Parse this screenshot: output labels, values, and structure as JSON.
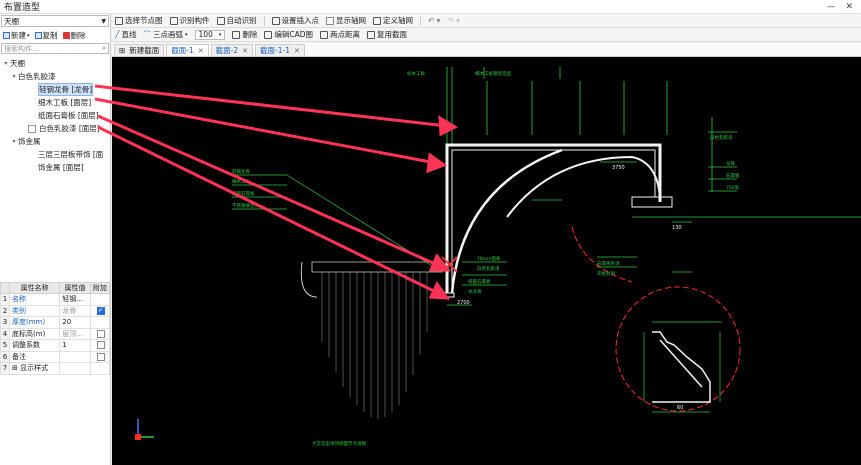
{
  "window": {
    "title": "布置造型",
    "minimize": "—",
    "close": "✕"
  },
  "left": {
    "category_select": "天棚",
    "toolbar": {
      "new_label": "新建",
      "copy_label": "复制",
      "delete_label": "删除"
    },
    "search_placeholder": "搜索构件...",
    "tree": {
      "root": "天棚",
      "group1": "白色乳胶漆",
      "g1_items": [
        "轻钢龙骨 [龙骨]",
        "细木工板 [面层]",
        "纸面石膏板 [面层]"
      ],
      "g1_sub": "白色乳胶漆 [面层]",
      "group2": "饰金属",
      "g2_items": [
        "三层三层板带饰 [面",
        "饰金属 [面层]"
      ]
    }
  },
  "props": {
    "headers": [
      "属性名称",
      "属性值",
      "附加"
    ],
    "rows": [
      {
        "num": "1",
        "name": "名称",
        "value": "轻钢...",
        "check": "none"
      },
      {
        "num": "2",
        "name": "类别",
        "value": "龙骨",
        "check": "on"
      },
      {
        "num": "3",
        "name": "厚度(mm)",
        "value": "20",
        "check": "none"
      },
      {
        "num": "4",
        "name": "底标高(m)",
        "value": "层顶...",
        "check": "off"
      },
      {
        "num": "5",
        "name": "调整系数",
        "value": "1",
        "check": "off"
      },
      {
        "num": "6",
        "name": "备注",
        "value": "",
        "check": "off"
      },
      {
        "num": "7",
        "name": "显示样式",
        "value": "",
        "check": "none"
      }
    ]
  },
  "toolbar1": [
    "选择节点图",
    "识别构件",
    "自动识别",
    "设置插入点",
    "显示轴网",
    "定义轴网"
  ],
  "toolbar1_undo": "↶ ▾",
  "toolbar1_redo": "↷ ▾",
  "toolbar2": {
    "line": "直线",
    "arc": "三点画弧",
    "zoom": "100",
    "delete": "删除",
    "edit_cad": "编辑CAD图",
    "two_point": "两点距离",
    "reuse": "复用截面"
  },
  "tabs": [
    "新建截面",
    "截面-1",
    "截面-2",
    "截面-1-1"
  ],
  "cad": {
    "labels_top": [
      "标木工板",
      "细木工板钢架造型"
    ],
    "labels_right": [
      "白色乳胶漆",
      "龙骨",
      "石膏板",
      "750宽"
    ],
    "dims": [
      "3750",
      "2700",
      "130",
      "60"
    ],
    "labels_left": [
      "轻钢龙骨",
      "细木工板",
      "纸面石膏板",
      "不锈钢收边条"
    ],
    "labels_mid": [
      "18mm面板",
      "白色乳胶漆",
      "纸面石膏板",
      "木龙骨"
    ],
    "labels_lower": [
      "石膏线吊顶",
      "夹板封顶"
    ],
    "drawing_title": "大堂造型吊顶侧面节点详图"
  },
  "colors": {
    "cad_bg": "#000000",
    "cad_white": "#ffffff",
    "cad_green": "#2ecc40",
    "cad_red": "#ff2a2a",
    "arrow": "#ff3355"
  }
}
